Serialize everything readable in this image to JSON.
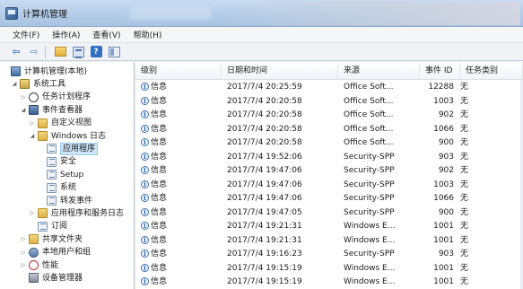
{
  "window": {
    "title": "计算机管理"
  },
  "menu": [
    "文件(F)",
    "操作(A)",
    "查看(V)",
    "帮助(H)"
  ],
  "toolbar": {
    "buttons": [
      {
        "icon": "back-arrow-icon",
        "glyph": "⇦"
      },
      {
        "icon": "forward-arrow-icon",
        "glyph": "⇨"
      },
      {
        "icon": "up-folder-icon"
      },
      {
        "icon": "show-hide-tree-icon"
      },
      {
        "icon": "help-icon",
        "glyph": "?"
      },
      {
        "icon": "action-pane-icon"
      }
    ]
  },
  "tree": [
    {
      "label": "计算机管理(本地)",
      "icon": "computer-icon",
      "indent": 0,
      "twisty": ""
    },
    {
      "label": "系统工具",
      "icon": "tools-icon",
      "indent": 1,
      "twisty": "◢"
    },
    {
      "label": "任务计划程序",
      "icon": "clock-icon",
      "indent": 2,
      "twisty": "▷"
    },
    {
      "label": "事件查看器",
      "icon": "event-viewer-icon",
      "indent": 2,
      "twisty": "◢"
    },
    {
      "label": "自定义视图",
      "icon": "folder-icon",
      "indent": 3,
      "twisty": "▷"
    },
    {
      "label": "Windows 日志",
      "icon": "folder-icon",
      "indent": 3,
      "twisty": "◢"
    },
    {
      "label": "应用程序",
      "icon": "log-icon",
      "indent": 4,
      "twisty": "",
      "selected": true
    },
    {
      "label": "安全",
      "icon": "log-icon",
      "indent": 4,
      "twisty": ""
    },
    {
      "label": "Setup",
      "icon": "log-icon",
      "indent": 4,
      "twisty": ""
    },
    {
      "label": "系统",
      "icon": "log-icon",
      "indent": 4,
      "twisty": ""
    },
    {
      "label": "转发事件",
      "icon": "log-icon",
      "indent": 4,
      "twisty": ""
    },
    {
      "label": "应用程序和服务日志",
      "icon": "folder-icon",
      "indent": 3,
      "twisty": "▷"
    },
    {
      "label": "订阅",
      "icon": "log-icon",
      "indent": 3,
      "twisty": ""
    },
    {
      "label": "共享文件夹",
      "icon": "shared-folder-icon",
      "indent": 2,
      "twisty": "▷"
    },
    {
      "label": "本地用户和组",
      "icon": "users-icon",
      "indent": 2,
      "twisty": "▷"
    },
    {
      "label": "性能",
      "icon": "performance-icon",
      "indent": 2,
      "twisty": "▷"
    },
    {
      "label": "设备管理器",
      "icon": "device-manager-icon",
      "indent": 2,
      "twisty": ""
    }
  ],
  "columns": [
    "级别",
    "日期和时间",
    "来源",
    "事件 ID",
    "任务类别"
  ],
  "level_icon": "information-icon",
  "events": [
    {
      "level": "信息",
      "datetime": "2017/7/4 20:25:59",
      "source": "Office Soft...",
      "id": "12288",
      "category": "无"
    },
    {
      "level": "信息",
      "datetime": "2017/7/4 20:20:58",
      "source": "Office Soft...",
      "id": "1003",
      "category": "无"
    },
    {
      "level": "信息",
      "datetime": "2017/7/4 20:20:58",
      "source": "Office Soft...",
      "id": "902",
      "category": "无"
    },
    {
      "level": "信息",
      "datetime": "2017/7/4 20:20:58",
      "source": "Office Soft...",
      "id": "1066",
      "category": "无"
    },
    {
      "level": "信息",
      "datetime": "2017/7/4 20:20:58",
      "source": "Office Soft...",
      "id": "900",
      "category": "无"
    },
    {
      "level": "信息",
      "datetime": "2017/7/4 19:52:06",
      "source": "Security-SPP",
      "id": "903",
      "category": "无"
    },
    {
      "level": "信息",
      "datetime": "2017/7/4 19:47:06",
      "source": "Security-SPP",
      "id": "902",
      "category": "无"
    },
    {
      "level": "信息",
      "datetime": "2017/7/4 19:47:06",
      "source": "Security-SPP",
      "id": "1003",
      "category": "无"
    },
    {
      "level": "信息",
      "datetime": "2017/7/4 19:47:06",
      "source": "Security-SPP",
      "id": "1066",
      "category": "无"
    },
    {
      "level": "信息",
      "datetime": "2017/7/4 19:47:05",
      "source": "Security-SPP",
      "id": "900",
      "category": "无"
    },
    {
      "level": "信息",
      "datetime": "2017/7/4 19:21:31",
      "source": "Windows E...",
      "id": "1001",
      "category": "无"
    },
    {
      "level": "信息",
      "datetime": "2017/7/4 19:21:31",
      "source": "Windows E...",
      "id": "1001",
      "category": "无"
    },
    {
      "level": "信息",
      "datetime": "2017/7/4 19:16:23",
      "source": "Security-SPP",
      "id": "903",
      "category": "无"
    },
    {
      "level": "信息",
      "datetime": "2017/7/4 19:15:19",
      "source": "Windows E...",
      "id": "1001",
      "category": "无"
    },
    {
      "level": "信息",
      "datetime": "2017/7/4 19:15:19",
      "source": "Windows E...",
      "id": "1001",
      "category": "无"
    }
  ]
}
